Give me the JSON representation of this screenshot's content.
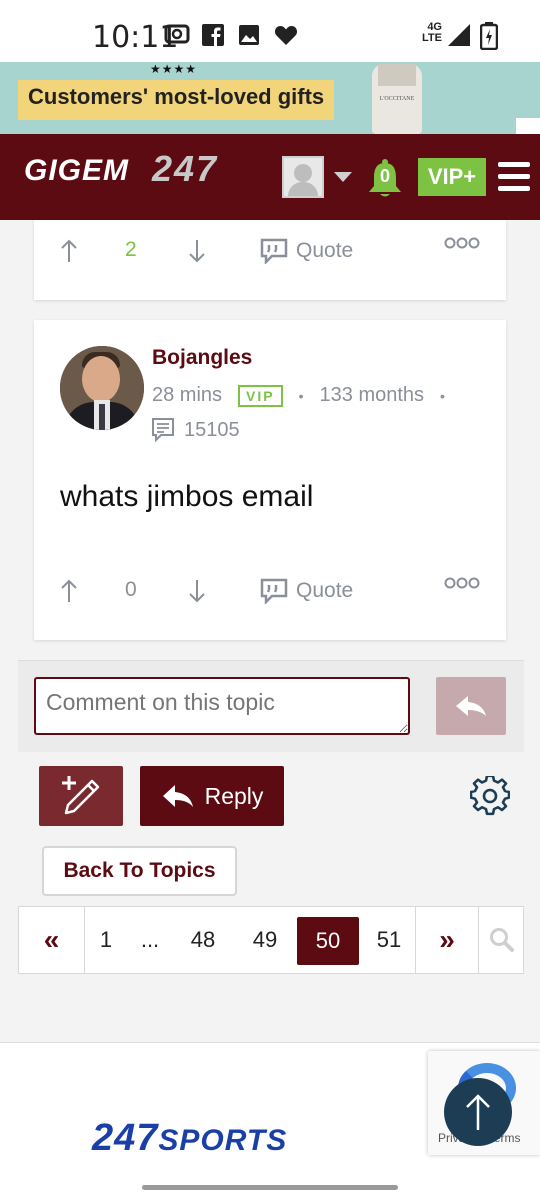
{
  "status_bar": {
    "time": "10:11",
    "network": "4G LTE"
  },
  "ad": {
    "stars": "★★★★",
    "text": "Customers' most-loved gifts",
    "product_label": "L'OCCITANE"
  },
  "header": {
    "logo_text": "GIGEM",
    "logo_number": "247",
    "notification_count": "0",
    "vip_label": "VIP+"
  },
  "posts": [
    {
      "upvote_count": "2",
      "quote_label": "Quote"
    },
    {
      "username": "Bojangles",
      "time_ago": "28 mins",
      "badge": "VIP",
      "tenure": "133 months",
      "post_count": "15105",
      "body": "whats jimbos email",
      "upvote_count": "0",
      "quote_label": "Quote"
    }
  ],
  "comment": {
    "placeholder": "Comment on this topic"
  },
  "toolbar": {
    "reply_label": "Reply"
  },
  "back_label": "Back To Topics",
  "pager": {
    "first": "«",
    "pages": [
      "1",
      "...",
      "48",
      "49",
      "50",
      "51"
    ],
    "current": "50",
    "last": "»"
  },
  "footer": {
    "logo_num": "247",
    "logo_word": "SPORTS",
    "recaptcha_text": "Privacy - Terms"
  },
  "colors": {
    "brand_maroon": "#5c0b12",
    "vip_green": "#7dc243",
    "muted_text": "#8a8f99"
  }
}
